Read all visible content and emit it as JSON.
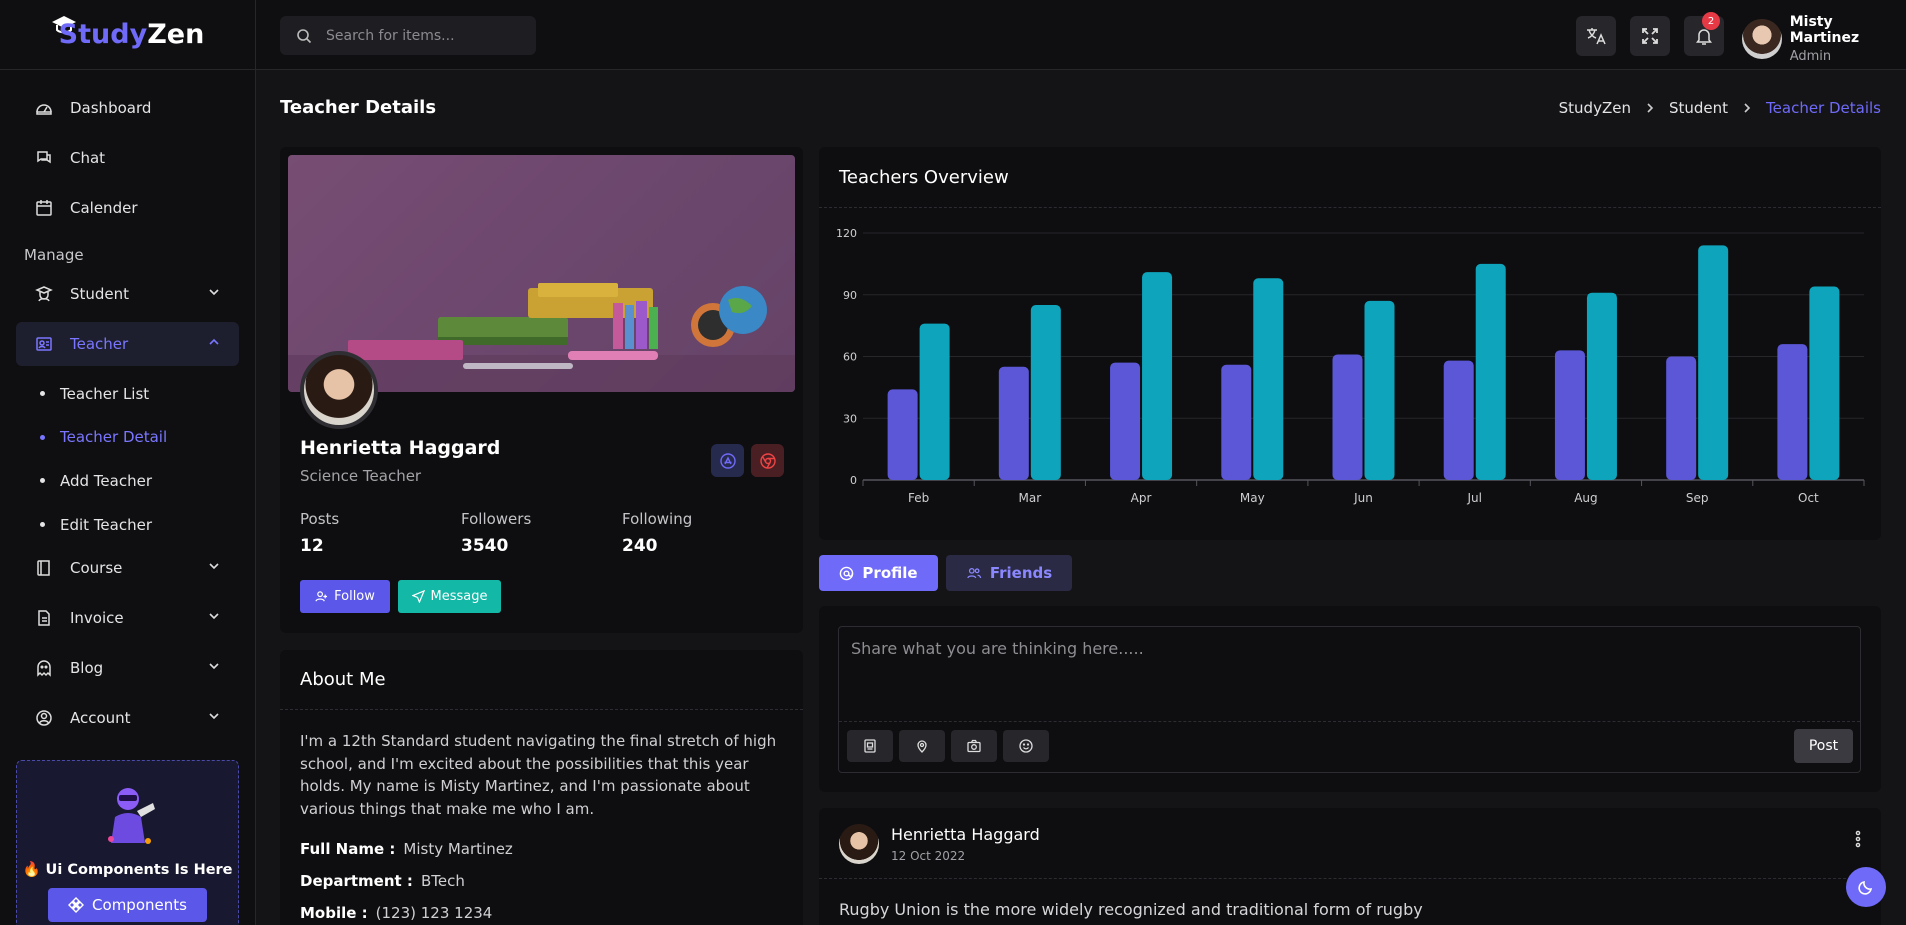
{
  "brand": {
    "part1": "Study",
    "part2": "Zen"
  },
  "search": {
    "placeholder": "Search for items..."
  },
  "topbar": {
    "notifications_count": "2",
    "user_name": "Misty Martinez",
    "user_role": "Admin"
  },
  "sidebar": {
    "items_top": [
      {
        "label": "Dashboard",
        "icon": "dashboard-icon"
      },
      {
        "label": "Chat",
        "icon": "chat-icon"
      },
      {
        "label": "Calender",
        "icon": "calendar-icon"
      }
    ],
    "section_label": "Manage",
    "student_label": "Student",
    "teacher_label": "Teacher",
    "teacher_sub": [
      "Teacher List",
      "Teacher Detail",
      "Add Teacher",
      "Edit Teacher"
    ],
    "items_bottom": [
      {
        "label": "Course",
        "icon": "book-icon"
      },
      {
        "label": "Invoice",
        "icon": "invoice-icon"
      },
      {
        "label": "Blog",
        "icon": "blog-icon"
      },
      {
        "label": "Account",
        "icon": "account-icon"
      }
    ],
    "promo_title": "🔥 Ui Components Is Here",
    "promo_button": "Components"
  },
  "page": {
    "title": "Teacher Details",
    "breadcrumb": [
      "StudyZen",
      "Student",
      "Teacher Details"
    ]
  },
  "profile": {
    "name": "Henrietta Haggard",
    "role": "Science Teacher",
    "stats": [
      {
        "label": "Posts",
        "value": "12"
      },
      {
        "label": "Followers",
        "value": "3540"
      },
      {
        "label": "Following",
        "value": "240"
      }
    ],
    "follow_label": "Follow",
    "message_label": "Message"
  },
  "about": {
    "title": "About Me",
    "text": "I'm a 12th Standard student navigating the final stretch of high school, and I'm excited about the possibilities that this year holds. My name is Misty Martinez, and I'm passionate about various things that make me who I am.",
    "full_name_label": "Full Name :",
    "full_name": "Misty Martinez",
    "department_label": "Department :",
    "department": "BTech",
    "mobile_label": "Mobile :",
    "mobile": "(123) 123 1234"
  },
  "overview": {
    "title": "Teachers Overview"
  },
  "chart_data": {
    "type": "bar",
    "categories": [
      "Feb",
      "Mar",
      "Apr",
      "May",
      "Jun",
      "Jul",
      "Aug",
      "Sep",
      "Oct"
    ],
    "series": [
      {
        "values": [
          44,
          55,
          57,
          56,
          61,
          58,
          63,
          60,
          66
        ],
        "color": "#5b57d6"
      },
      {
        "values": [
          76,
          85,
          101,
          98,
          87,
          105,
          91,
          114,
          94
        ],
        "color": "#0ea5bc"
      }
    ],
    "ylim": [
      0,
      120
    ],
    "yticks": [
      "0",
      "30",
      "60",
      "90",
      "120"
    ]
  },
  "tabs": {
    "profile": "Profile",
    "friends": "Friends"
  },
  "compose": {
    "placeholder": "Share what you are thinking here.....",
    "post_label": "Post"
  },
  "feed_post": {
    "author": "Henrietta Haggard",
    "date": "12 Oct 2022",
    "text": "Rugby Union is the more widely recognized and traditional form of rugby"
  }
}
